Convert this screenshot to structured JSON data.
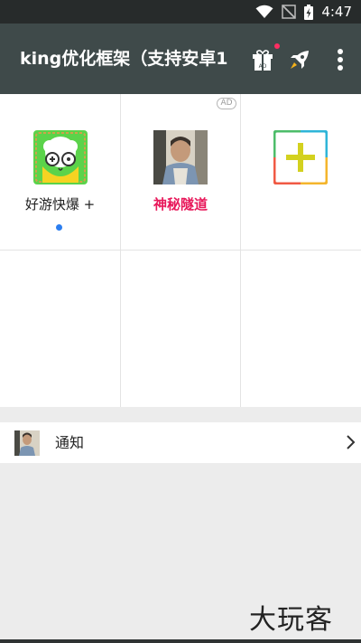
{
  "status_bar": {
    "time": "4:47",
    "icons": [
      "wifi-icon",
      "no-signal-icon",
      "battery-charging-icon"
    ]
  },
  "toolbar": {
    "title": "king优化框架（支持安卓1",
    "gift_badge": "AD",
    "icons": [
      "gift-icon",
      "rocket-icon",
      "more-vert-icon"
    ],
    "colors": {
      "background": "#3f4a4a",
      "notification_dot": "#ff2d62"
    }
  },
  "apps": [
    {
      "label": "好游快爆 +",
      "icon": "haoyou-app-icon",
      "has_new_dot": true
    },
    {
      "label": "神秘隧道",
      "icon": "portrait-thumbnail",
      "ad_badge": "AD",
      "label_color": "#e8185a"
    },
    {
      "label": "",
      "icon": "add-app-icon"
    }
  ],
  "notification_row": {
    "label": "通知",
    "icon": "portrait-thumbnail",
    "trailing_icon": "chevron-right-icon"
  },
  "watermark": "大玩客"
}
